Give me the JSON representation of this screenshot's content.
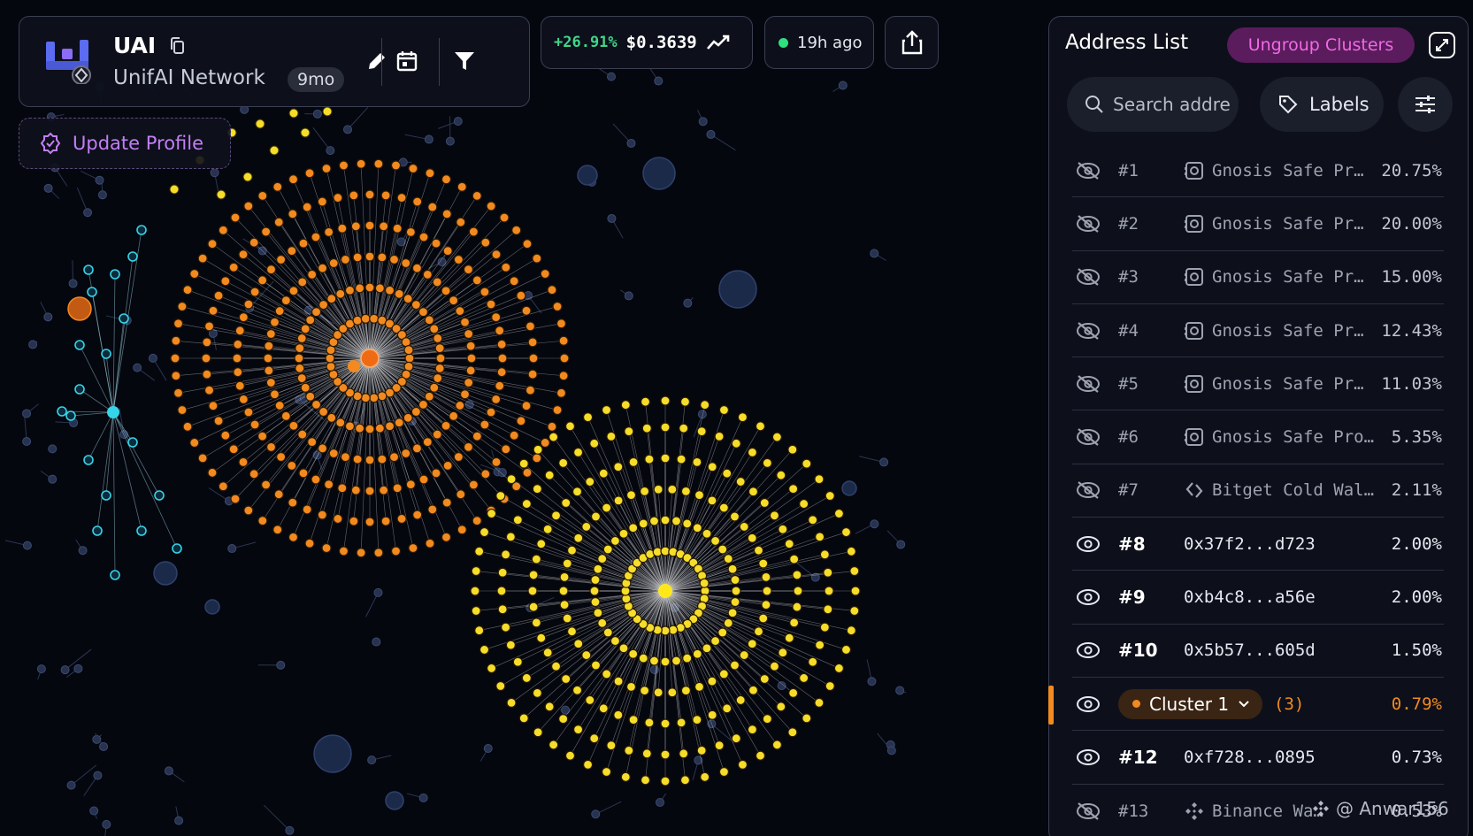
{
  "token": {
    "symbol": "UAI",
    "name": "UnifAI Network",
    "age": "9mo"
  },
  "update_profile": {
    "label": "Update Profile"
  },
  "price": {
    "change": "+26.91%",
    "value": "$0.3639"
  },
  "updated": {
    "label": "19h ago"
  },
  "address_list": {
    "title": "Address List",
    "ungroup_label": "Ungroup Clusters",
    "search_placeholder": "Search addre",
    "labels_label": "Labels",
    "rows": [
      {
        "rank": "#1",
        "name": "Gnosis Safe Pr…",
        "pct": "20.75%",
        "hidden": true,
        "icon": "safe-icon"
      },
      {
        "rank": "#2",
        "name": "Gnosis Safe Pr…",
        "pct": "20.00%",
        "hidden": true,
        "icon": "safe-icon"
      },
      {
        "rank": "#3",
        "name": "Gnosis Safe Pr…",
        "pct": "15.00%",
        "hidden": true,
        "icon": "safe-icon"
      },
      {
        "rank": "#4",
        "name": "Gnosis Safe Pr…",
        "pct": "12.43%",
        "hidden": true,
        "icon": "safe-icon"
      },
      {
        "rank": "#5",
        "name": "Gnosis Safe Pr…",
        "pct": "11.03%",
        "hidden": true,
        "icon": "safe-icon"
      },
      {
        "rank": "#6",
        "name": "Gnosis Safe Pro…",
        "pct": "5.35%",
        "hidden": true,
        "icon": "safe-icon"
      },
      {
        "rank": "#7",
        "name": "Bitget Cold Wal…",
        "pct": "2.11%",
        "hidden": true,
        "icon": "bitget-icon"
      },
      {
        "rank": "#8",
        "name": "0x37f2...d723",
        "pct": "2.00%",
        "hidden": false
      },
      {
        "rank": "#9",
        "name": "0xb4c8...a56e",
        "pct": "2.00%",
        "hidden": false
      },
      {
        "rank": "#10",
        "name": "0x5b57...605d",
        "pct": "1.50%",
        "hidden": false
      },
      {
        "cluster": true,
        "name": "Cluster 1",
        "count": "(3)",
        "pct": "0.79%",
        "hidden": false
      },
      {
        "rank": "#12",
        "name": "0xf728...0895",
        "pct": "0.73%",
        "hidden": false
      },
      {
        "rank": "#13",
        "name": "Binance Wa…",
        "pct": "0.53%",
        "hidden": true,
        "icon": "binance-icon"
      }
    ]
  },
  "watermark": {
    "text": "@ Anwar156"
  },
  "colors": {
    "orange_cluster": "#f28a1f",
    "yellow_cluster": "#f5dd2a",
    "cyan_cluster": "#35d4e8",
    "background": "#05070f",
    "accent_pink": "#f06ae4",
    "price_up": "#3fd68a"
  }
}
